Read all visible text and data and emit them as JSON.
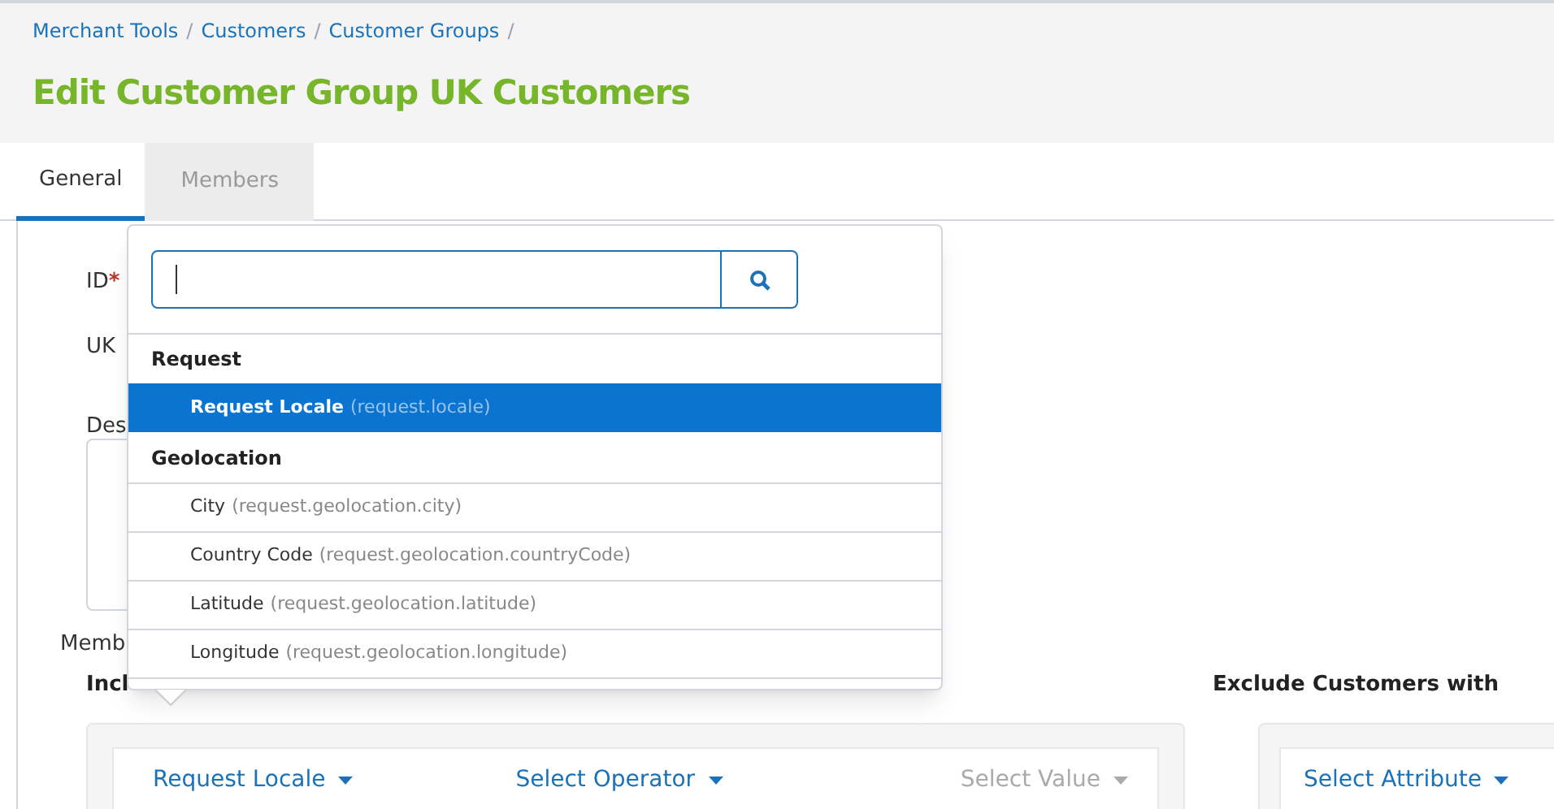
{
  "breadcrumb": [
    "Merchant Tools",
    "Customers",
    "Customer Groups"
  ],
  "breadcrumb_separator": "/",
  "title": "Edit Customer Group UK Customers",
  "tabs": [
    {
      "label": "General",
      "selected": true
    },
    {
      "label": "Members",
      "selected": false
    }
  ],
  "form": {
    "id_label": "ID",
    "required_mark": "*",
    "name_value": "UK",
    "description_label": "Des",
    "members_label": "Memb",
    "include_label": "Incl"
  },
  "include_rule": {
    "attribute": "Request Locale",
    "operator": "Select Operator",
    "value": "Select Value"
  },
  "exclude": {
    "label": "Exclude Customers with",
    "attribute": "Select Attribute"
  },
  "dropdown": {
    "groups": [
      {
        "label": "Request",
        "items": [
          {
            "label": "Request Locale",
            "path": "(request.locale)",
            "selected": true
          }
        ]
      },
      {
        "label": "Geolocation",
        "items": [
          {
            "label": "City",
            "path": "(request.geolocation.city)",
            "selected": false
          },
          {
            "label": "Country Code",
            "path": "(request.geolocation.countryCode)",
            "selected": false
          },
          {
            "label": "Latitude",
            "path": "(request.geolocation.latitude)",
            "selected": false
          },
          {
            "label": "Longitude",
            "path": "(request.geolocation.longitude)",
            "selected": false
          }
        ]
      }
    ]
  }
}
